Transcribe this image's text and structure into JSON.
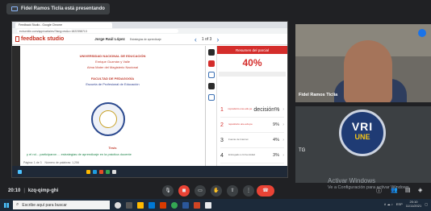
{
  "presenter": {
    "label": "Fidel Ramos Ticlia está presentando"
  },
  "browser": {
    "tab_title": "Feedback Studio - Google Chrome",
    "url": "ev.turnitin.com/app/carta/es/?lang=es&o=1822358713"
  },
  "feedback_studio": {
    "logo": "feedback studio",
    "doc_author": "Jorge Raúl López",
    "doc_sub": "Estrategias de aprendizaje",
    "page_indicator": "1 of 3",
    "page_count_label": "Página: 1 de 3",
    "words_label": "Número de palabras: 1,256",
    "similarity_header": "Resumen del parcial",
    "similarity_pct": "40%",
    "sources": [
      {
        "num": "1",
        "text": "repositorio.une.edu.pe",
        "pct": "decisión%",
        "color": "red"
      },
      {
        "num": "2",
        "text": "repositorio.une.edu.pe",
        "pct": "9%",
        "color": "red"
      },
      {
        "num": "3",
        "text": "Fuente de Internet",
        "pct": "4%",
        "color": "gray"
      },
      {
        "num": "4",
        "text": "Entregado a Universidad",
        "pct": "3%",
        "color": "gray"
      },
      {
        "num": "5",
        "text": "Entregado a Universidad",
        "pct": "3%",
        "color": "gray"
      }
    ],
    "doc_lines": [
      "UNIVERSIDAD NACIONAL DE EDUCACIÓN",
      "Enrique Guzmán y Valle",
      "Alma Mater del Magisterio Nacional",
      "FACULTAD DE PEDAGOGÍA",
      "Escuela de Profesional de Educación"
    ],
    "doc_small": "Tesis",
    "doc_footer": "y el rol... participaron ... estrategias de aprendizaje en la práctica docente"
  },
  "participants": {
    "video_name": "Fidel Ramos Ticlia",
    "logo_top": "VRI",
    "logo_bottom": "UNE",
    "tile_name": "TG"
  },
  "windows_activation": {
    "title": "Activar Windows",
    "subtitle": "Ve a Configuración para activar Windows."
  },
  "meet": {
    "time": "20:10",
    "separator": "|",
    "code": "kzq-qimp-ghi"
  },
  "taskbar": {
    "search_placeholder": "Escribe aquí para buscar",
    "time": "20:10",
    "date": "11/11/2021",
    "lang": "ESP"
  }
}
